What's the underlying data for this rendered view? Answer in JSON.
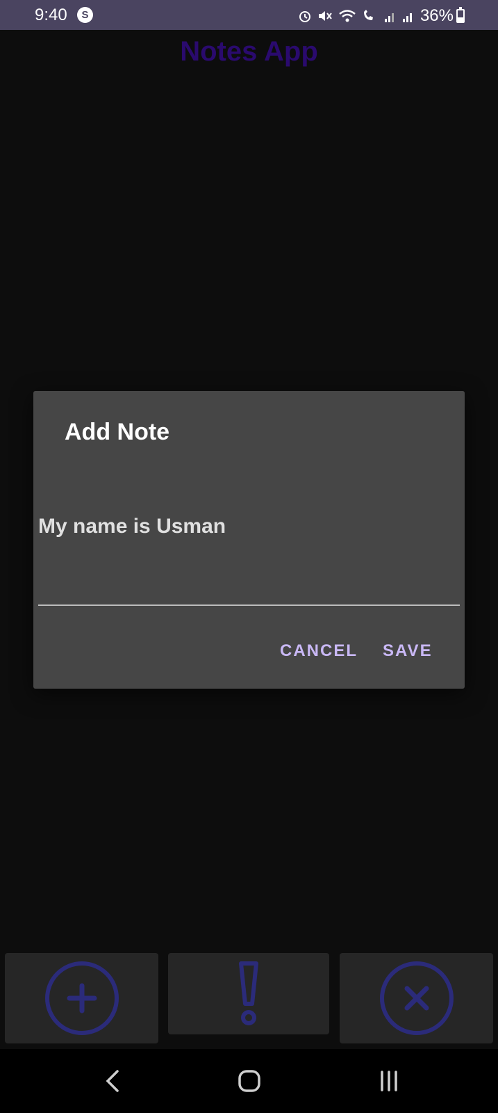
{
  "status_bar": {
    "time": "9:40",
    "app_icon_glyph": "S",
    "battery": "36%",
    "icons": [
      "alarm-icon",
      "mute-icon",
      "wifi-icon",
      "wifi-call-icon",
      "signal-icon",
      "signal-icon"
    ]
  },
  "app": {
    "title": "Notes App"
  },
  "dialog": {
    "title": "Add Note",
    "note_value": "My name is Usman",
    "cancel_label": "CANCEL",
    "save_label": "SAVE"
  },
  "action_bar": {
    "icons": [
      "add-circle-icon",
      "exclamation-icon",
      "close-circle-icon"
    ]
  },
  "nav_bar": {
    "icons": [
      "back-icon",
      "home-icon",
      "recents-icon"
    ]
  },
  "colors": {
    "status_bar_bg": "#4a4460",
    "title_color": "#2a0a6e",
    "dialog_bg": "#464646",
    "accent_button": "#c9b8f5",
    "icon_blue": "#2b2b7a"
  }
}
